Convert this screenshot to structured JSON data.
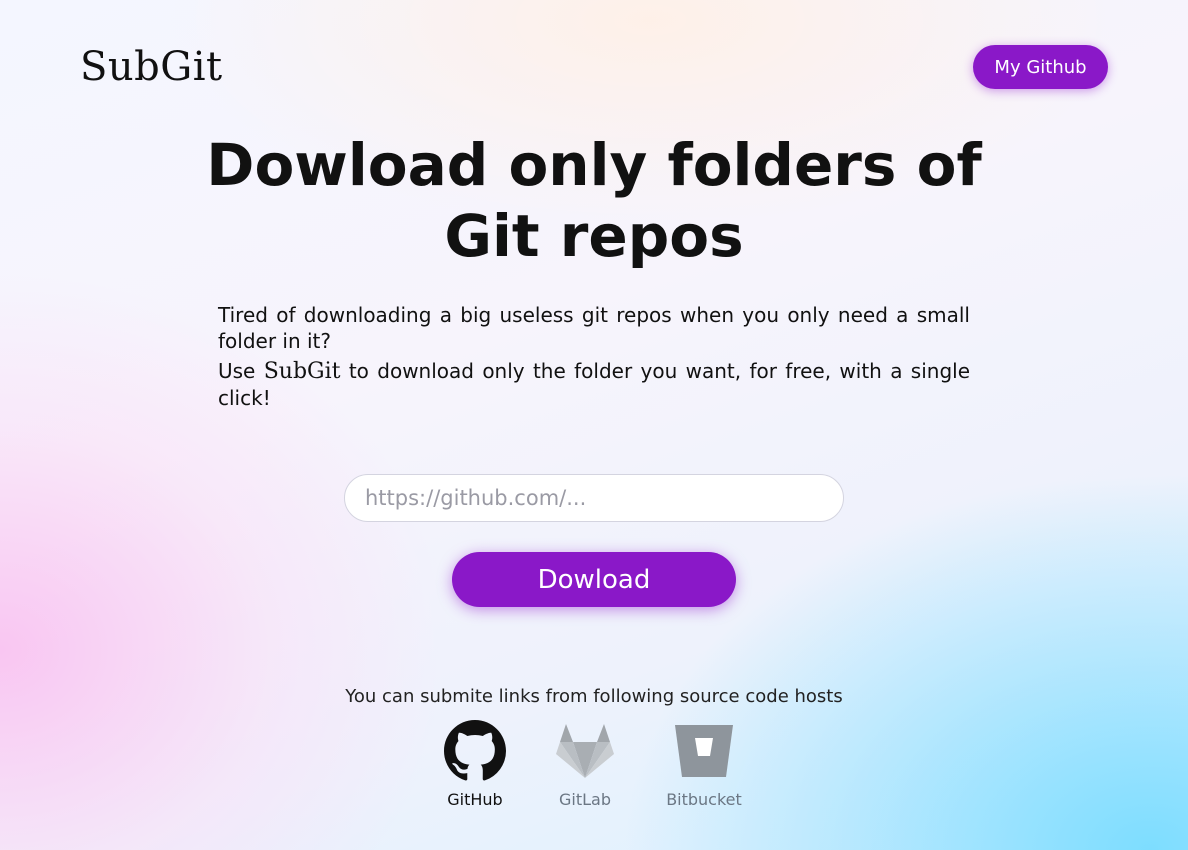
{
  "header": {
    "logo": "SubGit",
    "github_button": "My Github"
  },
  "hero": {
    "title": "Dowload only folders of Git repos",
    "intro_line1": "Tired of downloading a big useless git repos when you only need a small folder in it?",
    "intro_line2_before": "Use ",
    "intro_line2_brand": "SubGit",
    "intro_line2_after": " to download only the folder you want, for free, with a single click!"
  },
  "form": {
    "url_placeholder": "https://github.com/...",
    "url_value": "",
    "download_label": "Dowload"
  },
  "hosts": {
    "caption": "You can submite links from following source code hosts",
    "items": [
      {
        "label": "GitHub",
        "icon": "github-icon",
        "color": "#111111"
      },
      {
        "label": "GitLab",
        "icon": "gitlab-icon",
        "color": "#8e959c"
      },
      {
        "label": "Bitbucket",
        "icon": "bitbucket-icon",
        "color": "#8e959c"
      }
    ]
  },
  "colors": {
    "accent": "#8a18c8",
    "muted_host": "#8e959c"
  }
}
